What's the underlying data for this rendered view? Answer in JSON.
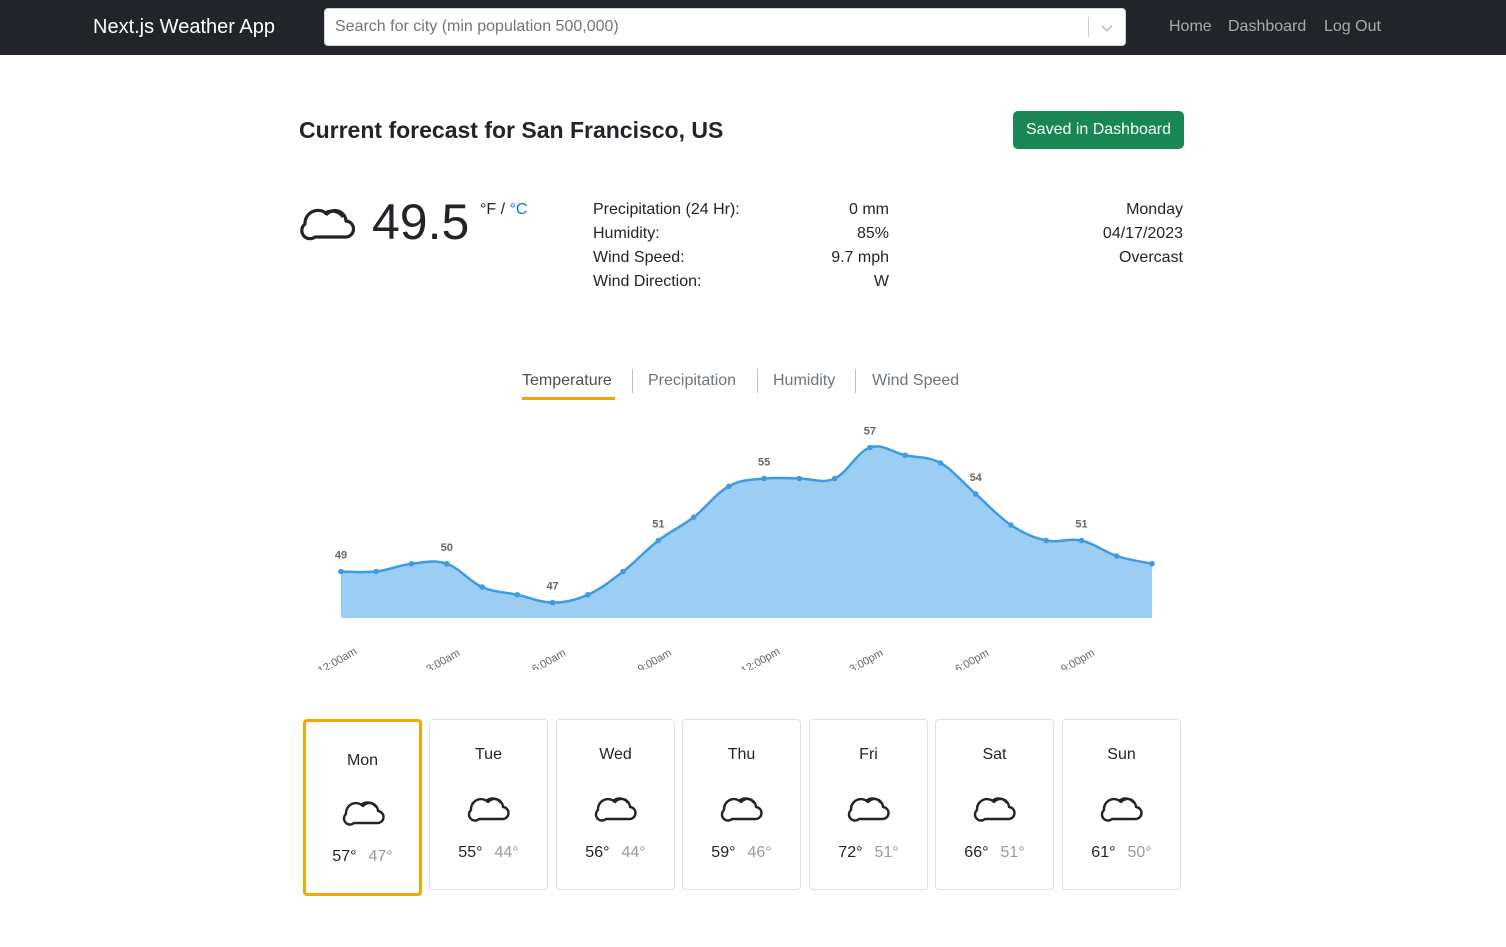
{
  "navbar": {
    "brand": "Next.js Weather App",
    "search_placeholder": "Search for city (min population 500,000)",
    "links": {
      "home": "Home",
      "dashboard": "Dashboard",
      "logout": "Log Out"
    }
  },
  "forecast": {
    "title": "Current forecast for San Francisco, US",
    "saved_button": "Saved in Dashboard",
    "current_temp": "49.5",
    "unit_f": "°F",
    "unit_sep": "/",
    "unit_c": "°C",
    "stats": [
      {
        "label": "Precipitation (24 Hr):",
        "value": "0 mm"
      },
      {
        "label": "Humidity:",
        "value": "85%"
      },
      {
        "label": "Wind Speed:",
        "value": "9.7 mph"
      },
      {
        "label": "Wind Direction:",
        "value": "W"
      }
    ],
    "day_name": "Monday",
    "date": "04/17/2023",
    "condition": "Overcast",
    "icon": "cloud-icon"
  },
  "tabs": [
    "Temperature",
    "Precipitation",
    "Humidity",
    "Wind Speed"
  ],
  "active_tab": "Temperature",
  "colors": {
    "accent": "#f0a500",
    "series_line": "#3d9be3",
    "series_fill": "#9ccef3",
    "saved": "#198754",
    "link": "#0d6efd"
  },
  "chart_data": {
    "type": "area",
    "x_ticks": [
      "12:00am",
      "3:00am",
      "6:00am",
      "9:00am",
      "12:00pm",
      "3:00pm",
      "6:00pm",
      "9:00pm"
    ],
    "values": [
      49,
      49,
      49.5,
      49.5,
      48,
      47.5,
      47,
      47.5,
      49,
      51,
      52.5,
      54.5,
      55,
      55,
      55,
      57,
      56.5,
      56,
      54,
      52,
      51,
      51,
      50,
      49.5
    ],
    "data_labels": [
      {
        "index": 0,
        "text": "49"
      },
      {
        "index": 3,
        "text": "50"
      },
      {
        "index": 6,
        "text": "47"
      },
      {
        "index": 9,
        "text": "51"
      },
      {
        "index": 12,
        "text": "55"
      },
      {
        "index": 15,
        "text": "57"
      },
      {
        "index": 18,
        "text": "54"
      },
      {
        "index": 21,
        "text": "51"
      }
    ]
  },
  "days": [
    {
      "name": "Mon",
      "hi": "57°",
      "lo": "47°",
      "icon": "cloud-icon",
      "active": true
    },
    {
      "name": "Tue",
      "hi": "55°",
      "lo": "44°",
      "icon": "cloud-icon",
      "active": false
    },
    {
      "name": "Wed",
      "hi": "56°",
      "lo": "44°",
      "icon": "cloud-icon",
      "active": false
    },
    {
      "name": "Thu",
      "hi": "59°",
      "lo": "46°",
      "icon": "cloud-icon",
      "active": false
    },
    {
      "name": "Fri",
      "hi": "72°",
      "lo": "51°",
      "icon": "cloud-icon",
      "active": false
    },
    {
      "name": "Sat",
      "hi": "66°",
      "lo": "51°",
      "icon": "cloud-icon",
      "active": false
    },
    {
      "name": "Sun",
      "hi": "61°",
      "lo": "50°",
      "icon": "cloud-icon",
      "active": false
    }
  ]
}
